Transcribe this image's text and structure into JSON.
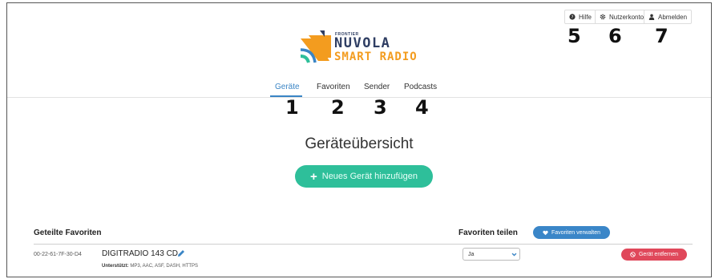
{
  "header": {
    "help_label": "Hilfe",
    "account_label": "Nutzerkonto",
    "logout_label": "Abmelden"
  },
  "logo": {
    "brand_top": "FRONTIER",
    "brand_main": "NUVOLA",
    "brand_sub": "SMART RADIO"
  },
  "nav": {
    "tabs": [
      {
        "label": "Geräte",
        "active": true
      },
      {
        "label": "Favoriten",
        "active": false
      },
      {
        "label": "Sender",
        "active": false
      },
      {
        "label": "Podcasts",
        "active": false
      }
    ]
  },
  "callouts": [
    "1",
    "2",
    "3",
    "4",
    "5",
    "6",
    "7"
  ],
  "main": {
    "title": "Geräteübersicht",
    "add_device_label": "Neues Gerät hinzufügen"
  },
  "table": {
    "col_shared": "Geteilte Favoriten",
    "col_share": "Favoriten teilen",
    "manage_label": "Favoriten verwalten",
    "rows": [
      {
        "mac": "00-22-61-7F-30-D4",
        "name": "DIGITRADIO 143 CD",
        "supports_label": "Unterstützt:",
        "supports_value": "MP3, AAC, ASF, DASH, HTTPS",
        "share_value": "Ja",
        "remove_label": "Gerät entfernen"
      }
    ]
  },
  "colors": {
    "accent": "#3a85c5",
    "add_button": "#2ebf9a",
    "remove_button": "#e0485b",
    "logo_navy": "#2f3e63",
    "logo_orange": "#f39c1f"
  }
}
